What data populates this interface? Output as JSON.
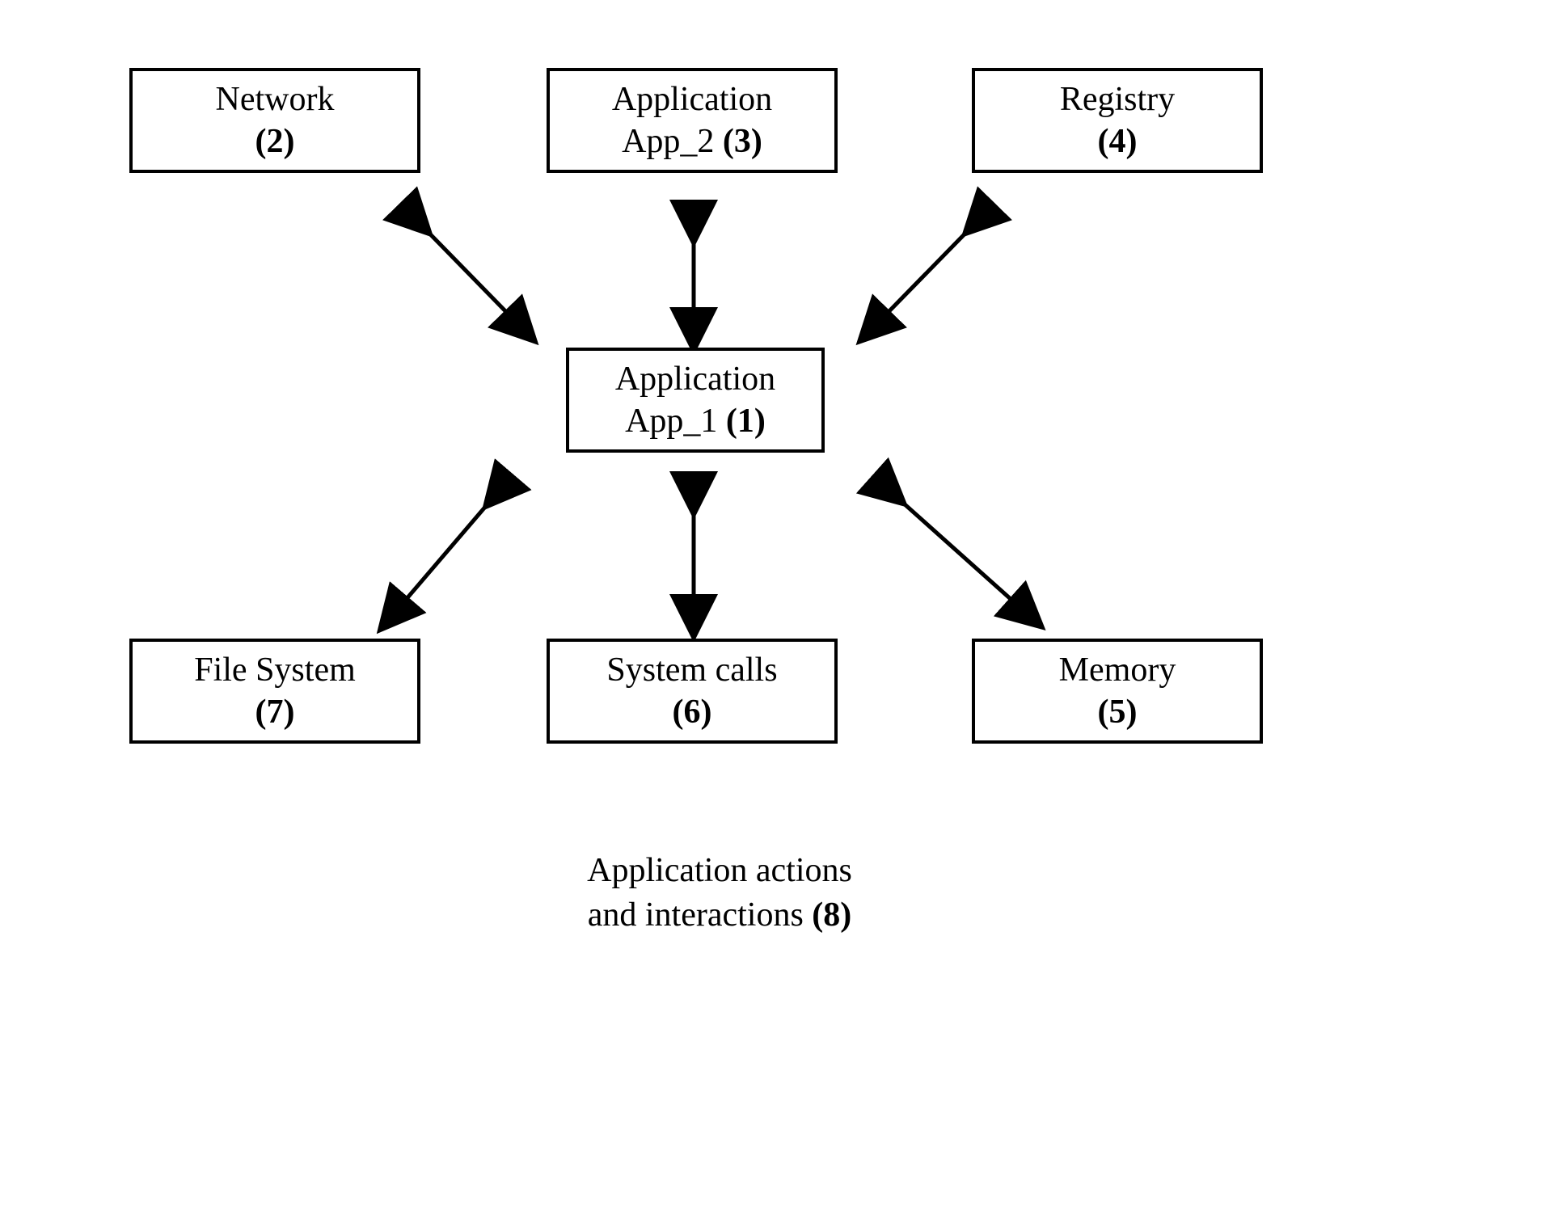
{
  "nodes": {
    "network": {
      "line1": "Network",
      "num": "(2)"
    },
    "app2": {
      "line1": "Application",
      "line2a": "App_2 ",
      "num": "(3)"
    },
    "registry": {
      "line1": "Registry",
      "num": "(4)"
    },
    "app1": {
      "line1": "Application",
      "line2a": "App_1 ",
      "num": "(1)"
    },
    "filesystem": {
      "line1": "File System",
      "num": "(7)"
    },
    "systemcalls": {
      "line1": "System calls",
      "num": "(6)"
    },
    "memory": {
      "line1": "Memory",
      "num": "(5)"
    }
  },
  "caption": {
    "line1": "Application actions",
    "line2a": "and interactions ",
    "num": "(8)"
  }
}
